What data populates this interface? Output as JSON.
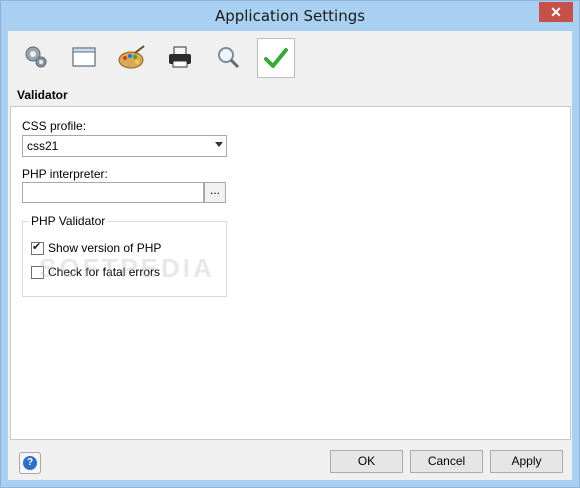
{
  "window": {
    "title": "Application Settings",
    "close_glyph": "✕"
  },
  "toolbar": {
    "buttons": [
      {
        "icon": "gears-icon",
        "active": false
      },
      {
        "icon": "window-icon",
        "active": false
      },
      {
        "icon": "palette-icon",
        "active": false
      },
      {
        "icon": "printer-icon",
        "active": false
      },
      {
        "icon": "magnifier-icon",
        "active": false
      },
      {
        "icon": "checkmark-icon",
        "active": true
      }
    ]
  },
  "section": {
    "title": "Validator"
  },
  "form": {
    "css_profile_label": "CSS profile:",
    "css_profile_value": "css21",
    "php_interpreter_label": "PHP interpreter:",
    "php_interpreter_value": "",
    "browse_label": "...",
    "php_validator_group": "PHP Validator",
    "show_version_label": "Show version of PHP",
    "show_version_checked": true,
    "check_fatal_label": "Check for fatal errors",
    "check_fatal_checked": false
  },
  "watermark": "SOFTPEDIA",
  "footer": {
    "help_glyph": "?",
    "ok_label": "OK",
    "cancel_label": "Cancel",
    "apply_label": "Apply"
  },
  "colors": {
    "titlebar": "#a9d0f0",
    "close": "#c7504a",
    "check_green": "#3aa935"
  }
}
